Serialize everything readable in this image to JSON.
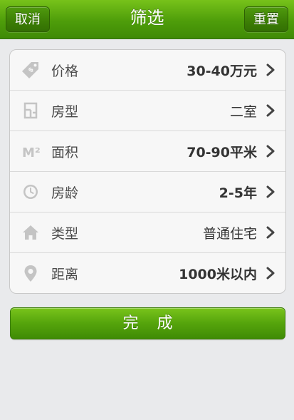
{
  "header": {
    "title": "筛选",
    "cancel_label": "取消",
    "reset_label": "重置"
  },
  "filters": [
    {
      "label": "价格",
      "value": "30-40万元",
      "icon": "price-tag-icon"
    },
    {
      "label": "房型",
      "value": "二室",
      "icon": "floor-plan-icon"
    },
    {
      "label": "面积",
      "value": "70-90平米",
      "icon": "square-meter-icon",
      "icon_text": "M²"
    },
    {
      "label": "房龄",
      "value": "2-5年",
      "icon": "clock-icon"
    },
    {
      "label": "类型",
      "value": "普通住宅",
      "icon": "house-icon"
    },
    {
      "label": "距离",
      "value": "1000米以内",
      "icon": "location-pin-icon"
    }
  ],
  "done_label": "完成",
  "colors": {
    "brand_green": "#5aa80e",
    "icon_gray": "#c4c4c4",
    "background": "#e9eaec"
  }
}
